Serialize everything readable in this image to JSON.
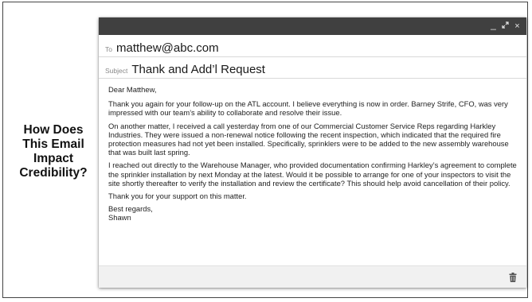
{
  "side_question": {
    "lines": [
      "How Does",
      "This Email",
      "Impact",
      "Credibility?"
    ]
  },
  "window": {
    "controls": {
      "minimize": "_",
      "expand": "⤢",
      "close": "×"
    }
  },
  "compose": {
    "to_label": "To",
    "to_value": "matthew@abc.com",
    "subject_label": "Subject",
    "subject_value": "Thank and Add’l Request"
  },
  "email_body": {
    "greeting": "Dear Matthew,",
    "paragraphs": [
      "Thank you again for your follow-up on the ATL account. I believe everything is now in order. Barney Strife, CFO, was very impressed with our team’s ability to collaborate and resolve their issue.",
      "On another matter, I received a call yesterday from one of our Commercial Customer Service Reps regarding Harkley Industries. They were issued a non-renewal notice following the recent inspection, which indicated that the required fire protection measures had not yet been installed. Specifically, sprinklers were to be added to the new assembly warehouse that was built last spring.",
      "I reached out directly to the Warehouse Manager, who provided documentation confirming Harkley’s agreement to complete the sprinkler installation by next Monday at the latest. Would it be possible to arrange for one of your inspectors to visit the site shortly thereafter to verify the installation and review the certificate? This should help avoid cancellation of their policy.",
      "Thank you for your support on this matter."
    ],
    "closing": "Best regards,",
    "signature": "Shawn"
  },
  "footer": {
    "trash_icon": "trash-icon"
  },
  "colors": {
    "titlebar": "#404040",
    "footer": "#f1f1f1",
    "border": "#444444"
  }
}
